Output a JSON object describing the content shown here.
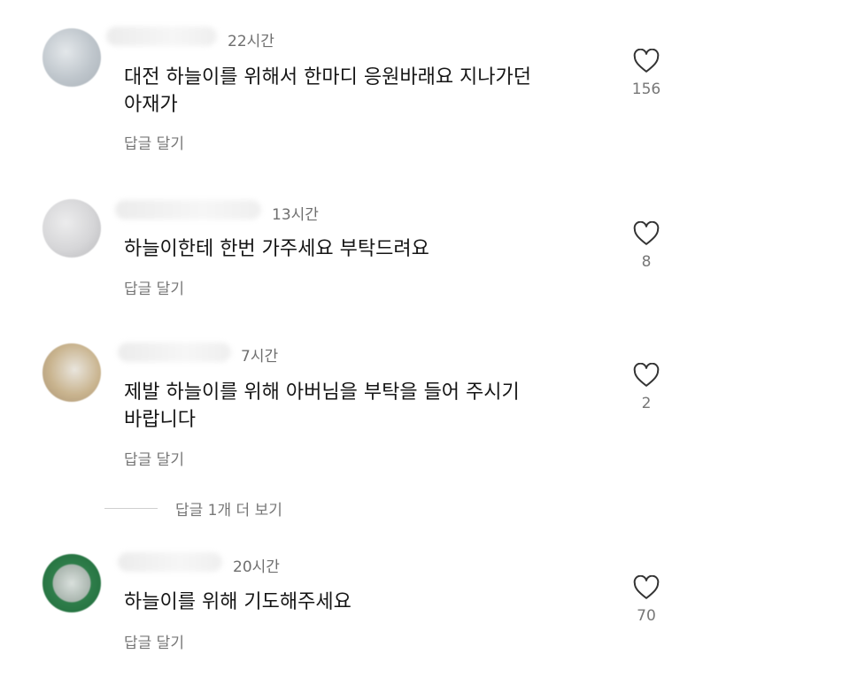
{
  "comments": [
    {
      "time": "22시간",
      "text": "대전 하늘이를 위해서 한마디 응원바래요 지나가던\n아재가",
      "reply_label": "답글 달기",
      "likes": "156",
      "avatar_color": "#bfc6cc"
    },
    {
      "time": "13시간",
      "text": "하늘이한테 한번 가주세요 부탁드려요",
      "reply_label": "답글 달기",
      "likes": "8",
      "avatar_color": "#d6d6d8"
    },
    {
      "time": "7시간",
      "text": "제발 하늘이를 위해 아버님을 부탁을 들어 주시기\n바랍니다",
      "reply_label": "답글 달기",
      "likes": "2",
      "avatar_color": "#c9b48f"
    },
    {
      "time": "20시간",
      "text": "하늘이를 위해 기도해주세요",
      "reply_label": "답글 달기",
      "likes": "70",
      "avatar_color": "#2e7d4a"
    }
  ],
  "view_more_replies": "답글 1개 더 보기",
  "heart_icon": "heart-outline-icon"
}
